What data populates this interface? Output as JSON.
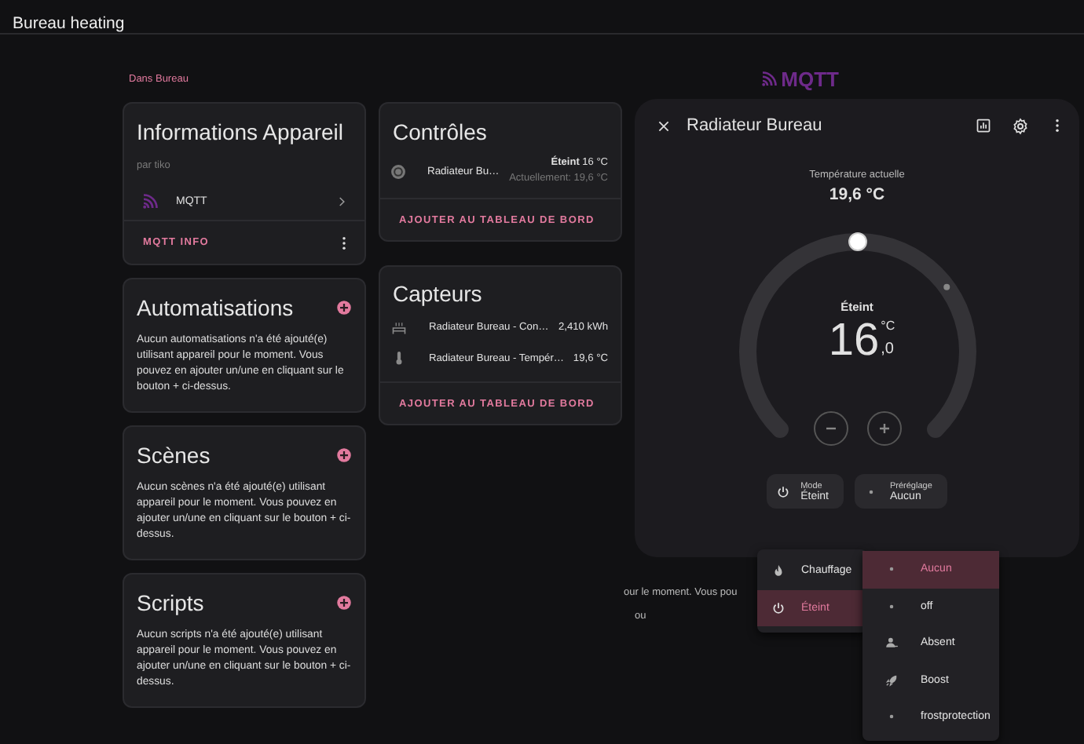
{
  "app_bar": {
    "title": "Bureau heating"
  },
  "breadcrumb": "Dans Bureau",
  "brand": {
    "logo_text": "MQTT"
  },
  "device_info": {
    "title": "Informations Appareil",
    "manufacturer": "par tiko",
    "integrations": [
      {
        "name": "MQTT"
      }
    ],
    "action": "MQTT INFO"
  },
  "empty_cards": [
    {
      "title": "Automatisations",
      "text": "Aucun automatisations n'a été ajouté(e) utilisant appareil pour le moment. Vous pouvez en ajouter un/une en cliquant sur le bouton + ci-dessus."
    },
    {
      "title": "Scènes",
      "text": "Aucun scènes n'a été ajouté(e) utilisant appareil pour le moment. Vous pouvez en ajouter un/une en cliquant sur le bouton + ci-dessus."
    },
    {
      "title": "Scripts",
      "text": "Aucun scripts n'a été ajouté(e) utilisant appareil pour le moment. Vous pouvez en ajouter un/une en cliquant sur le bouton + ci-dessus."
    }
  ],
  "controls": {
    "title": "Contrôles",
    "entities": [
      {
        "name": "Radiateur Bu…",
        "state": "Éteint",
        "target": "16 °C",
        "current": "Actuellement: 19,6 °C"
      }
    ],
    "action": "AJOUTER AU TABLEAU DE BORD"
  },
  "sensors": {
    "title": "Capteurs",
    "entities": [
      {
        "kind": "energy",
        "name": "Radiateur Bureau - Con…",
        "value": "2,410 kWh"
      },
      {
        "kind": "temperature",
        "name": "Radiateur Bureau - Tempér…",
        "value": "19,6 °C"
      }
    ],
    "action": "AJOUTER AU TABLEAU DE BORD"
  },
  "background_fragments": [
    "our le moment. Vous pou",
    "ou"
  ],
  "dialog": {
    "title": "Radiateur Bureau",
    "current_label": "Température actuelle",
    "current_value": "19,6 °C",
    "dial": {
      "level": 0.5,
      "state": "Éteint",
      "integer": "16",
      "decimal": ",0",
      "unit": "°C"
    },
    "chips": [
      {
        "kind": "mode",
        "label": "Mode",
        "value": "Éteint"
      },
      {
        "kind": "preset",
        "label": "Préréglage",
        "value": "Aucun"
      }
    ],
    "mode_menu": [
      {
        "kind": "heat",
        "label": "Chauffage",
        "selected": false
      },
      {
        "kind": "off",
        "label": "Éteint",
        "selected": true
      }
    ],
    "preset_menu": [
      {
        "kind": "dot",
        "label": "Aucun",
        "selected": true
      },
      {
        "kind": "dot",
        "label": "off",
        "selected": false
      },
      {
        "kind": "away",
        "label": "Absent",
        "selected": false
      },
      {
        "kind": "boost",
        "label": "Boost",
        "selected": false
      },
      {
        "kind": "dot",
        "label": "frostprotection",
        "selected": false
      }
    ]
  }
}
